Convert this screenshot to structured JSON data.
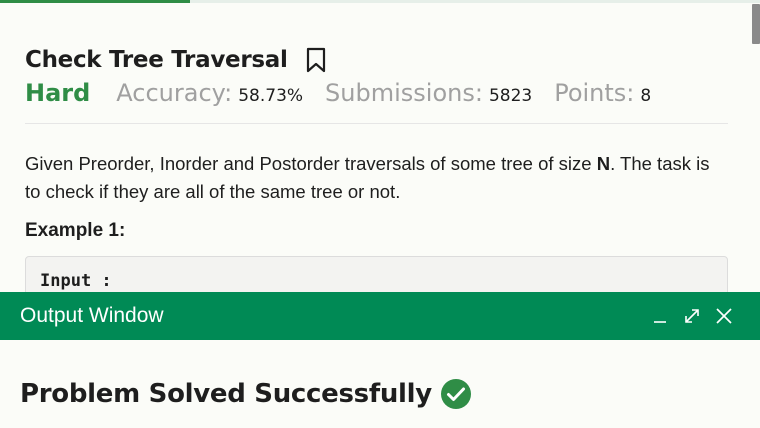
{
  "problem": {
    "title": "Check Tree Traversal",
    "difficulty": "Hard",
    "accuracy_label": "Accuracy:",
    "accuracy_value": "58.73%",
    "submissions_label": "Submissions:",
    "submissions_value": "5823",
    "points_label": "Points:",
    "points_value": "8",
    "description_part1": "Given Preorder, Inorder and Postorder traversals of some tree of size ",
    "description_bold": "N",
    "description_part2": ". The task is to check if they are all of the same tree or not.",
    "example_heading": "Example 1:",
    "example_input_label": "Input :"
  },
  "output_window": {
    "title": "Output Window",
    "status": "Problem Solved Successfully"
  },
  "icons": {
    "bookmark": "bookmark-icon",
    "minimize": "minimize-icon",
    "expand": "expand-icon",
    "close": "close-icon",
    "success": "check-circle-icon"
  },
  "colors": {
    "accent": "#2f8d46",
    "output_header": "#008a55",
    "muted": "#a0a0a0"
  }
}
